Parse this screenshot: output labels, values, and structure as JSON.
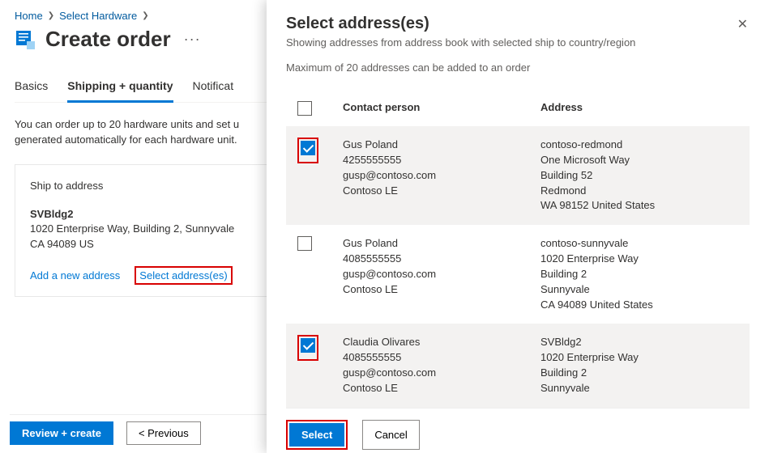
{
  "breadcrumb": {
    "home": "Home",
    "select_hw": "Select Hardware"
  },
  "page": {
    "title": "Create order",
    "more": "···",
    "tabs": {
      "basics": "Basics",
      "shipping": "Shipping + quantity",
      "notif": "Notificat"
    },
    "desc_l1": "You can order up to 20 hardware units and set u",
    "desc_l2": "generated automatically for each hardware unit."
  },
  "ship": {
    "label": "Ship to address",
    "name": "SVBldg2",
    "line1": "1020 Enterprise Way, Building 2, Sunnyvale",
    "line2": "CA 94089 US",
    "add_link": "Add a new address",
    "select_link": "Select address(es)"
  },
  "footer": {
    "review": "Review + create",
    "prev": "< Previous"
  },
  "panel": {
    "title": "Select address(es)",
    "sub": "Showing addresses from address book with selected ship to country/region",
    "note": "Maximum of 20 addresses can be added to an order",
    "col_contact": "Contact person",
    "col_addr": "Address",
    "select_btn": "Select",
    "cancel_btn": "Cancel",
    "rows": [
      {
        "checked": true,
        "contact_name": "Gus Poland",
        "contact_phone": "4255555555",
        "contact_email": "gusp@contoso.com",
        "contact_org": "Contoso LE",
        "addr_name": "contoso-redmond",
        "addr_l1": "One Microsoft Way",
        "addr_l2": "Building 52",
        "addr_l3": "Redmond",
        "addr_l4": "WA 98152 United States"
      },
      {
        "checked": false,
        "contact_name": "Gus Poland",
        "contact_phone": "4085555555",
        "contact_email": "gusp@contoso.com",
        "contact_org": "Contoso LE",
        "addr_name": "contoso-sunnyvale",
        "addr_l1": "1020 Enterprise Way",
        "addr_l2": "Building 2",
        "addr_l3": "Sunnyvale",
        "addr_l4": "CA 94089 United States"
      },
      {
        "checked": true,
        "contact_name": "Claudia Olivares",
        "contact_phone": "4085555555",
        "contact_email": "gusp@contoso.com",
        "contact_org": "Contoso LE",
        "addr_name": "SVBldg2",
        "addr_l1": "1020 Enterprise Way",
        "addr_l2": "Building 2",
        "addr_l3": "Sunnyvale",
        "addr_l4": ""
      }
    ]
  }
}
